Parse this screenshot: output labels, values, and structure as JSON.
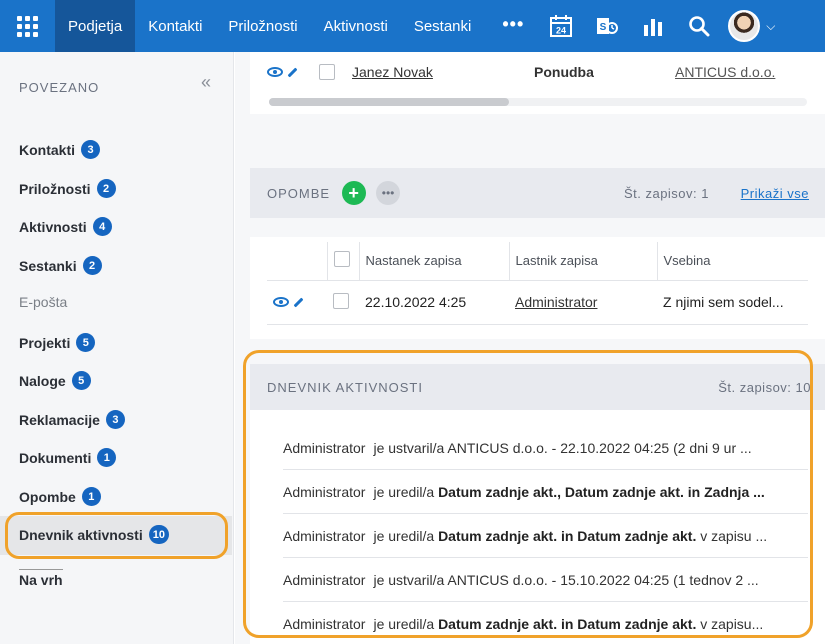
{
  "nav": {
    "items": [
      "Podjetja",
      "Kontakti",
      "Priložnosti",
      "Aktivnosti",
      "Sestanki"
    ],
    "active_index": 0,
    "more": "•••",
    "calendar_day": "24"
  },
  "sidebar": {
    "heading": "POVEZANO",
    "collapse": "«",
    "items": [
      {
        "label": "Kontakti",
        "count": "3"
      },
      {
        "label": "Priložnosti",
        "count": "2"
      },
      {
        "label": "Aktivnosti",
        "count": "4"
      },
      {
        "label": "Sestanki",
        "count": "2"
      },
      {
        "label": "E-pošta",
        "count": ""
      },
      {
        "label": "Projekti",
        "count": "5"
      },
      {
        "label": "Naloge",
        "count": "5"
      },
      {
        "label": "Reklamacije",
        "count": "3"
      },
      {
        "label": "Dokumenti",
        "count": "1"
      },
      {
        "label": "Opombe",
        "count": "1"
      },
      {
        "label": "Dnevnik aktivnosti",
        "count": "10"
      }
    ],
    "to_top": "Na vrh"
  },
  "top_row": {
    "name": "Janez Novak",
    "type": "Ponudba",
    "company": "ANTICUS d.o.o."
  },
  "notes": {
    "title": "OPOMBE",
    "plus": "+",
    "more": "•••",
    "count": "Št. zapisov: 1",
    "show_all": "Prikaži vse",
    "columns": [
      "Nastanek zapisa",
      "Lastnik zapisa",
      "Vsebina"
    ],
    "row": {
      "created": "22.10.2022 4:25",
      "owner": "Administrator",
      "content": "Z njimi sem sodel..."
    }
  },
  "log": {
    "title": "DNEVNIK AKTIVNOSTI",
    "count": "Št. zapisov: 10",
    "rows": [
      {
        "user": "Administrator",
        "pre": "je ustvaril/a ANTICUS d.o.o. - 22.10.2022 04:25 (2 dni 9 ur ...",
        "bold": "",
        "post": ""
      },
      {
        "user": "Administrator",
        "pre": "je uredil/a ",
        "bold": "Datum zadnje akt., Datum zadnje akt. in Zadnja ...",
        "post": ""
      },
      {
        "user": "Administrator",
        "pre": "je uredil/a ",
        "bold": "Datum zadnje akt. in Datum zadnje akt.",
        "post": " v zapisu ..."
      },
      {
        "user": "Administrator",
        "pre": "je ustvaril/a ANTICUS d.o.o. - 15.10.2022 04:25 (1 tednov 2 ...",
        "bold": "",
        "post": ""
      },
      {
        "user": "Administrator",
        "pre": "je uredil/a ",
        "bold": "Datum zadnje akt. in Datum zadnje akt.",
        "post": " v zapisu..."
      }
    ]
  },
  "colors": {
    "brand": "#1a73c9",
    "brand_dark": "#15569a",
    "highlight": "#f0a22a",
    "badge": "#1565c0",
    "add": "#1db954"
  }
}
